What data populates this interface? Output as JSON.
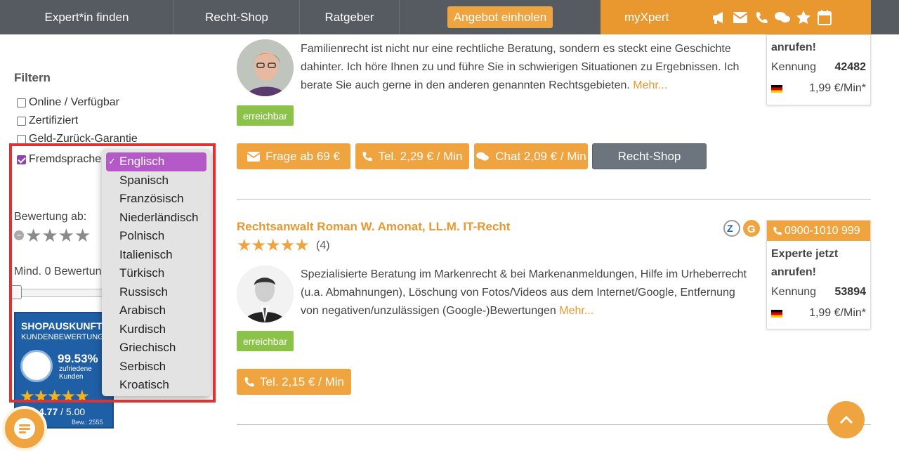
{
  "nav": {
    "items": [
      "Expert*in finden",
      "Recht-Shop",
      "Ratgeber"
    ],
    "cta": "Angebot einholen",
    "myxpert": "myXpert"
  },
  "sidebar": {
    "title": "Filtern",
    "checkboxes": [
      {
        "label": "Online / Verfügbar",
        "checked": false
      },
      {
        "label": "Zertifiziert",
        "checked": false
      },
      {
        "label": "Geld-Zurück-Garantie",
        "checked": false
      },
      {
        "label": "Fremdsprache",
        "checked": true
      }
    ],
    "rating_label": "Bewertung ab:",
    "min_reviews_label": "Mind. 0 Bewertungen",
    "shop_badge": {
      "title": "SHOPAUSKUNFT",
      "subtitle": "KUNDENBEWERTUNGEN",
      "percent": "99.53%",
      "satisfied": "zufriedene",
      "customers": "Kunden",
      "score": "4.77",
      "score_max": "/ 5.00",
      "reviews": "Bew.: 2555"
    }
  },
  "language_dropdown": {
    "selected": "Englisch",
    "options": [
      "Englisch",
      "Spanisch",
      "Französisch",
      "Niederländisch",
      "Polnisch",
      "Italienisch",
      "Türkisch",
      "Russisch",
      "Arabisch",
      "Kurdisch",
      "Griechisch",
      "Serbisch",
      "Kroatisch"
    ]
  },
  "expert1": {
    "description": "Familienrecht ist nicht nur eine rechtliche Beratung, sondern es steckt eine Geschichte dahinter. Ich höre Ihnen zu und führe Sie in schwierigen Situationen zu Ergebnissen. Ich berate Sie auch gerne in den anderen genannten Rechtsgebieten.",
    "more": "Mehr...",
    "status": "erreichbar",
    "buttons": {
      "question": "Frage ab 69 €",
      "phone": "Tel. 2,29 € / Min",
      "chat": "Chat 2,09 € / Min",
      "shop": "Recht-Shop"
    },
    "card": {
      "call_text": "anrufen!",
      "id_label": "Kennung",
      "id_value": "42482",
      "price": "1,99 €/Min*"
    }
  },
  "expert2": {
    "name": "Rechtsanwalt Roman W. Amonat, LL.M. IT-Recht",
    "rating": 5,
    "review_count": "(4)",
    "description": "Spezialisierte Beratung im Markenrecht & bei Markenanmeldungen, Hilfe im Urheberrecht (u.a. Abmahnungen), Löschung von Fotos/Videos aus dem Internet/Google, Entfernung von negativen/unzulässigen (Google-)Bewertungen",
    "more": "Mehr...",
    "status": "erreichbar",
    "buttons": {
      "phone": "Tel. 2,15 € / Min"
    },
    "card": {
      "phone_number": "0900-1010 999",
      "call_text": "Experte jetzt anrufen!",
      "id_label": "Kennung",
      "id_value": "53894",
      "price": "1,99 €/Min*"
    }
  },
  "colors": {
    "accent": "#f0a43f",
    "nav_bg": "#555b60",
    "selected_option": "#b459c7",
    "status_green": "#8bc34a",
    "highlight_box": "#e53030"
  }
}
